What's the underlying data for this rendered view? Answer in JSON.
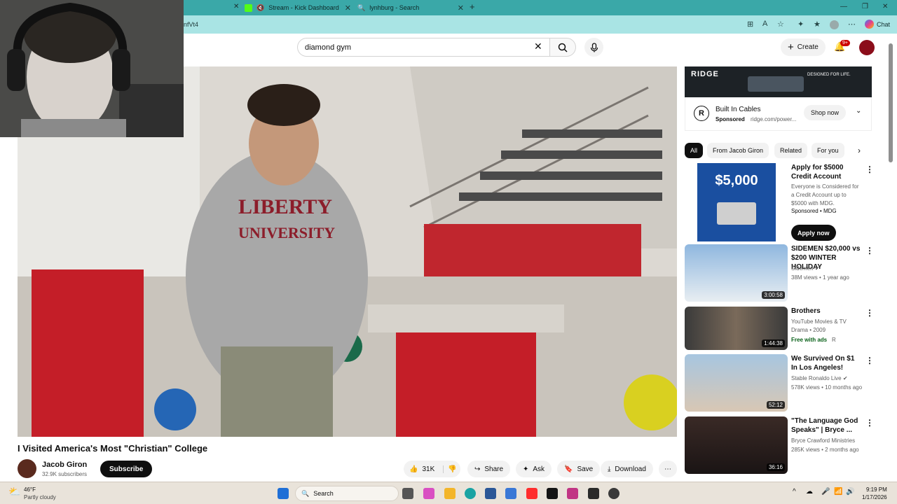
{
  "browser": {
    "tabs": [
      {
        "label": "Stream - Kick Dashboard"
      },
      {
        "label": "lynhburg - Search"
      }
    ],
    "address_fragment": "nfVt4",
    "chat_label": "Chat"
  },
  "youtube": {
    "search_value": "diamond gym",
    "create_label": "Create",
    "notifications_badge": "9+"
  },
  "video": {
    "title": "I Visited America's Most \"Christian\" College",
    "channel_name": "Jacob Giron",
    "channel_subs": "32.9K subscribers",
    "subscribe_label": "Subscribe",
    "likes": "31K",
    "share_label": "Share",
    "ask_label": "Ask",
    "save_label": "Save",
    "download_label": "Download"
  },
  "ad": {
    "banner_brand": "RIDGE",
    "banner_tagline": "DESIGNED FOR LIFE.",
    "title": "Built In Cables",
    "sponsored": "Sponsored",
    "domain": "ridge.com/power...",
    "cta": "Shop now"
  },
  "chips": [
    "All",
    "From Jacob Giron",
    "Related",
    "For you"
  ],
  "recommendations": [
    {
      "title": "Apply for $5000 Credit Account",
      "meta": "Everyone is Considered for a Credit Account up to $5000 with MDG.",
      "channel": "Sponsored • MDG",
      "cta": "Apply now",
      "thumb_text": "$5,000"
    },
    {
      "title": "SIDEMEN $20,000 vs $200 WINTER HOLIDAY",
      "channel": "Sidemen",
      "meta": "38M views • 1 year ago",
      "duration": "3:00:58"
    },
    {
      "title": "Brothers",
      "channel": "YouTube Movies & TV",
      "meta": "Drama • 2009",
      "badge": "Free with ads",
      "rating": "R",
      "duration": "1:44:38"
    },
    {
      "title": "We Survived On $1 In Los Angeles!",
      "channel": "Stable Ronaldo Live",
      "meta": "578K views • 10 months ago",
      "duration": "52:12"
    },
    {
      "title": "\"The Language God Speaks\" | Bryce ...",
      "channel": "Bryce Crawford Ministries",
      "meta": "285K views • 2 months ago",
      "duration": "36:16"
    }
  ],
  "taskbar": {
    "weather_temp": "46°F",
    "weather_desc": "Partly cloudy",
    "search_placeholder": "Search",
    "time": "9:19 PM",
    "date": "1/17/2026"
  }
}
